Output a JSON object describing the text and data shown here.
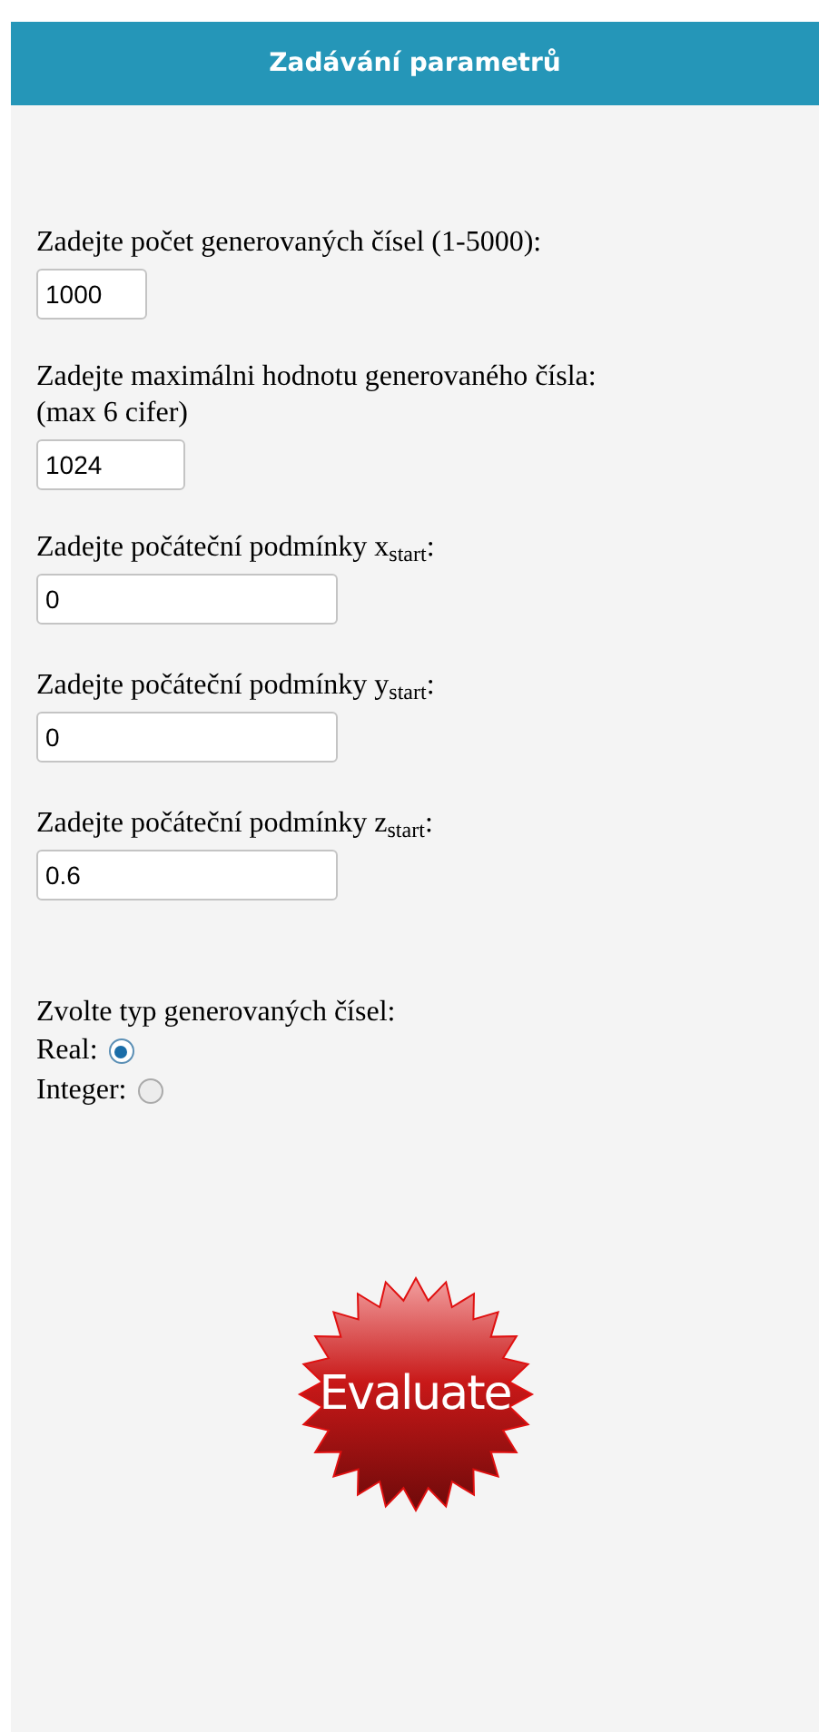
{
  "header": {
    "title": "Zadávání parametrů"
  },
  "fields": [
    {
      "label": "Zadejte počet generovaných čísel (1-5000):",
      "value": "1000"
    },
    {
      "label": "Zadejte maximálni hodnotu generovaného čísla:",
      "note": "(max 6 cifer)",
      "value": "1024"
    },
    {
      "label": "Zadejte počáteční podmínky x$_{start}$:",
      "value": "0"
    },
    {
      "label": "Zadejte počáteční podmínky y$_{start}$:",
      "value": "0"
    },
    {
      "label": "Zadejte počáteční podmínky z$_{start}$:",
      "value": "0.6"
    }
  ],
  "number_type": {
    "label": "Zvolte typ generovaných čísel:",
    "options": [
      {
        "label": "Real:",
        "selected": true
      },
      {
        "label": "Integer:",
        "selected": false
      }
    ]
  },
  "submit": {
    "label": "Evaluate"
  }
}
